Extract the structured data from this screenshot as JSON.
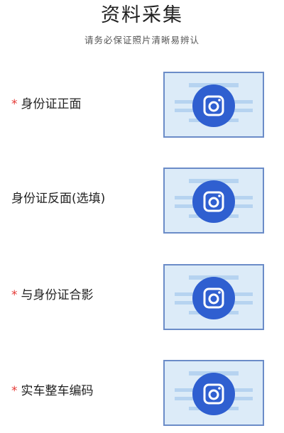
{
  "header": {
    "title": "资料采集",
    "subtitle": "请务必保证照片清晰易辨认"
  },
  "colors": {
    "required_mark": "#e53935",
    "card_border": "#6b8cc8",
    "card_bg": "#dcebf8",
    "card_lines": "#b6d3f0",
    "camera_circle": "#2f5fd0"
  },
  "upload_items": [
    {
      "required_mark": "*",
      "label": "身份证正面",
      "icon": "camera-icon"
    },
    {
      "required_mark": "",
      "label": "身份证反面(选填)",
      "icon": "camera-icon"
    },
    {
      "required_mark": "*",
      "label": "与身份证合影",
      "icon": "camera-icon"
    },
    {
      "required_mark": "*",
      "label": "实车整车编码",
      "icon": "camera-icon"
    }
  ]
}
